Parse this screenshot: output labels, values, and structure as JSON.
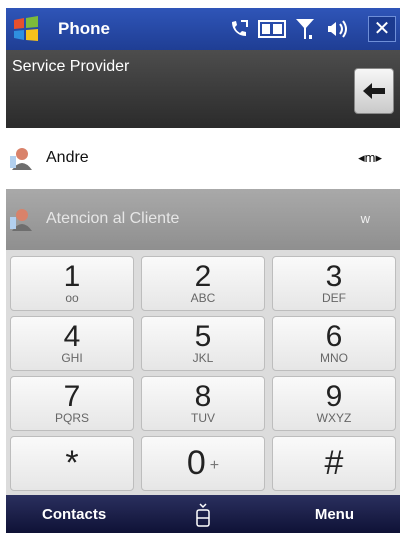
{
  "titlebar": {
    "title": "Phone",
    "close_label": "✕",
    "icons": [
      "windows-logo-icon",
      "missed-call-icon",
      "3g-icon",
      "signal-icon",
      "volume-icon"
    ],
    "accent_color": "#2f55b8"
  },
  "dial": {
    "provider": "Service Provider"
  },
  "matches": [
    {
      "name": "Andre",
      "type": "◂m▸"
    },
    {
      "name": "Atencion al Cliente",
      "type": "w"
    }
  ],
  "keypad": [
    {
      "digit": "1",
      "letters": "oo"
    },
    {
      "digit": "2",
      "letters": "ABC"
    },
    {
      "digit": "3",
      "letters": "DEF"
    },
    {
      "digit": "4",
      "letters": "GHI"
    },
    {
      "digit": "5",
      "letters": "JKL"
    },
    {
      "digit": "6",
      "letters": "MNO"
    },
    {
      "digit": "7",
      "letters": "PQRS"
    },
    {
      "digit": "8",
      "letters": "TUV"
    },
    {
      "digit": "9",
      "letters": "WXYZ"
    },
    {
      "digit": "*",
      "letters": ""
    },
    {
      "digit": "0",
      "letters": "+"
    },
    {
      "digit": "#",
      "letters": ""
    }
  ],
  "bottombar": {
    "left": "Contacts",
    "right": "Menu"
  }
}
